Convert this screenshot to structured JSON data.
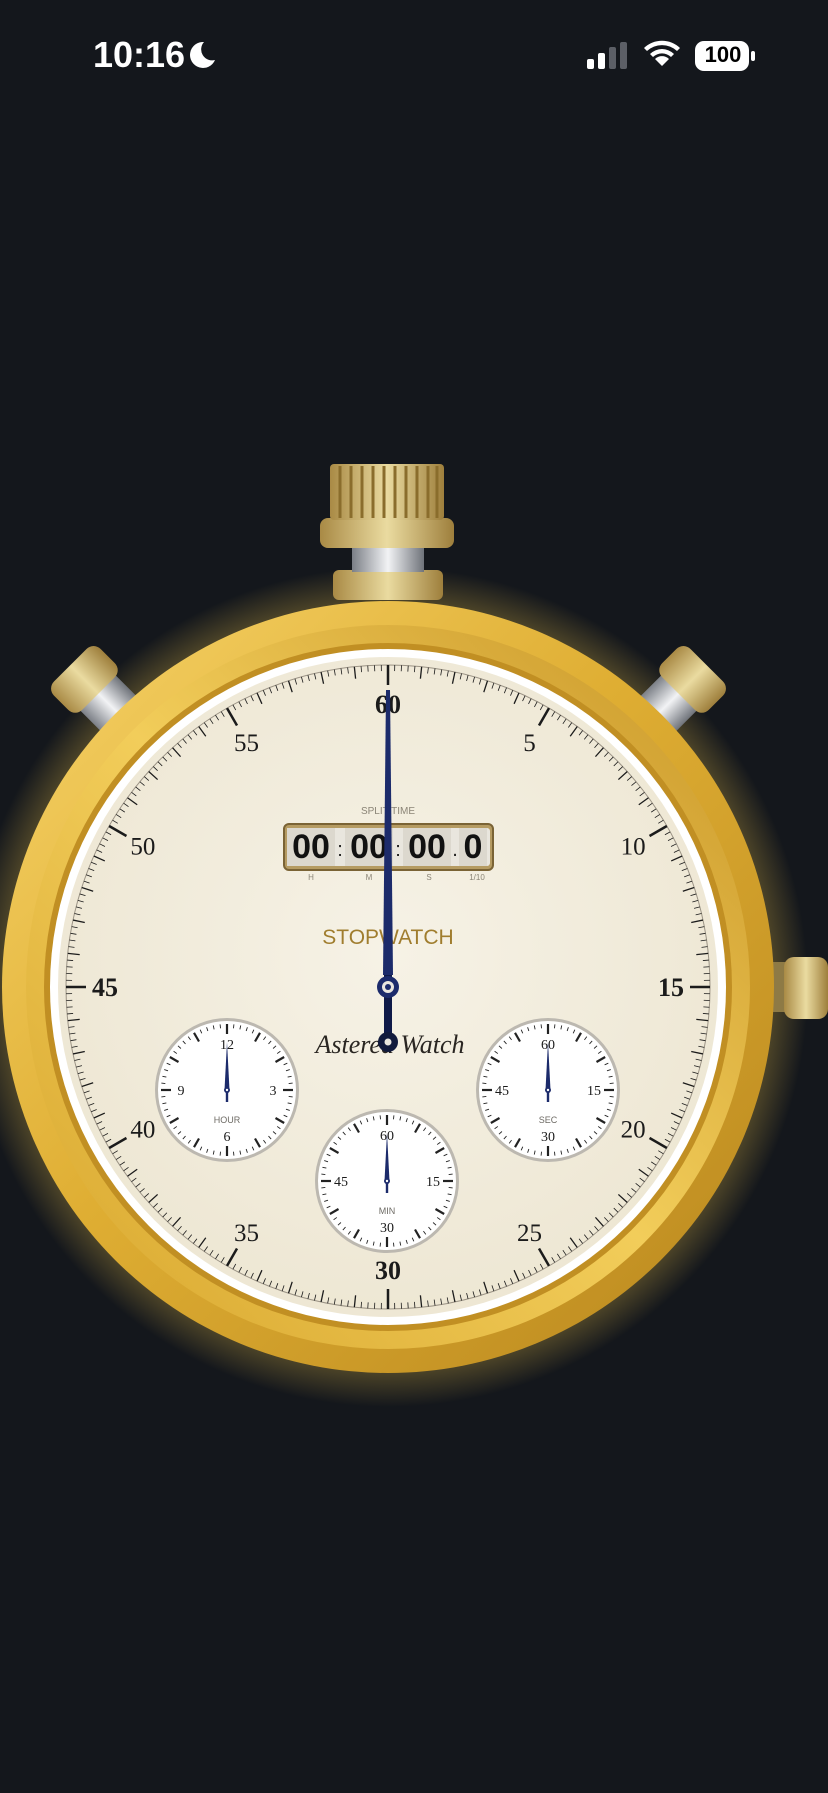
{
  "status_bar": {
    "time": "10:16",
    "moon_icon": "moon-icon",
    "signal_icon": "cellular-signal-icon",
    "wifi_icon": "wifi-icon",
    "battery_icon": "battery-icon",
    "battery_level": "100"
  },
  "watch": {
    "main_dial_numbers": [
      "60",
      "5",
      "10",
      "15",
      "20",
      "25",
      "30",
      "35",
      "40",
      "45",
      "50",
      "55"
    ],
    "split_label": "SPLIT TIME",
    "split_digits": [
      "00",
      "00",
      "00",
      "0"
    ],
    "split_units": [
      "H",
      "M",
      "S",
      "1/10"
    ],
    "title": "STOPWATCH",
    "brand": "Astered Watch",
    "hour_dial": {
      "label": "HOUR",
      "numbers": [
        "12",
        "3",
        "6",
        "9"
      ]
    },
    "sec_dial": {
      "label": "SEC",
      "numbers": [
        "60",
        "15",
        "30",
        "45"
      ]
    },
    "min_dial": {
      "label": "MIN",
      "numbers": [
        "60",
        "15",
        "30",
        "45"
      ]
    },
    "colors": {
      "background": "#14171c",
      "gold": "#e2b43a",
      "dial_face": "#f3efe2",
      "hand": "#1c2b6b",
      "title_text": "#a07d2e"
    }
  }
}
